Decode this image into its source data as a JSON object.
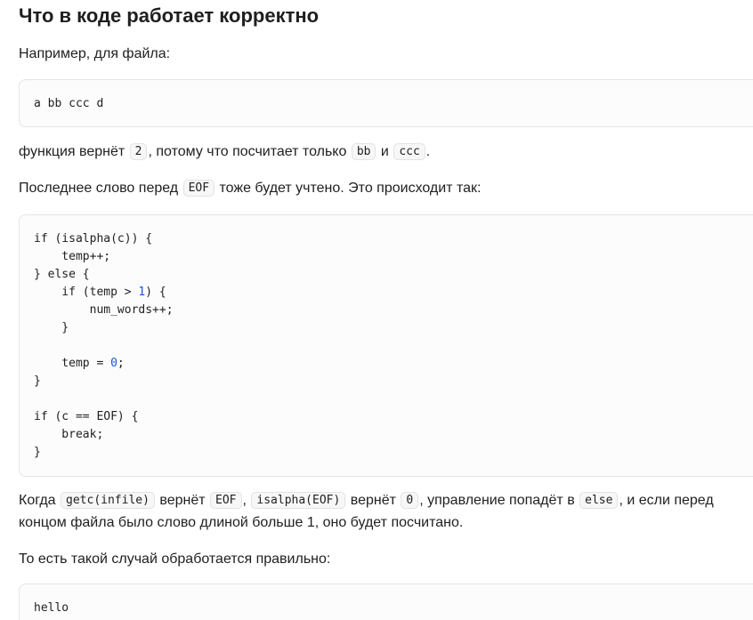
{
  "heading": "Что в коде работает корректно",
  "intro": "Например, для файла:",
  "example_file": "a bb ccc d",
  "result_line": {
    "t1": "функция вернёт ",
    "c1": "2",
    "t2": ", потому что посчитает только ",
    "c2": "bb",
    "t3": " и ",
    "c3": "ccc",
    "t4": "."
  },
  "eof_line": {
    "t1": "Последнее слово перед ",
    "c1": "EOF",
    "t2": " тоже будет учтено. Это происходит так:"
  },
  "code_lines": [
    "if (isalpha(c)) {",
    "    temp++;",
    "} else {",
    "    if (temp > §1§) {",
    "        num_words++;",
    "    }",
    "",
    "    temp = §0§;",
    "}",
    "",
    "if (c == EOF) {",
    "    break;",
    "}"
  ],
  "explain": {
    "t1": "Когда ",
    "c1": "getc(infile)",
    "t2": " вернёт ",
    "c2": "EOF",
    "t3": ", ",
    "c3": "isalpha(EOF)",
    "t4": " вернёт ",
    "c4": "0",
    "t5": ", управление попадёт в ",
    "c5": "else",
    "t6": ", и если перед",
    "line2": "концом файла было слово длиной больше 1, оно будет посчитано."
  },
  "case_line": "То есть такой случай обработается правильно:",
  "example2": "hello"
}
